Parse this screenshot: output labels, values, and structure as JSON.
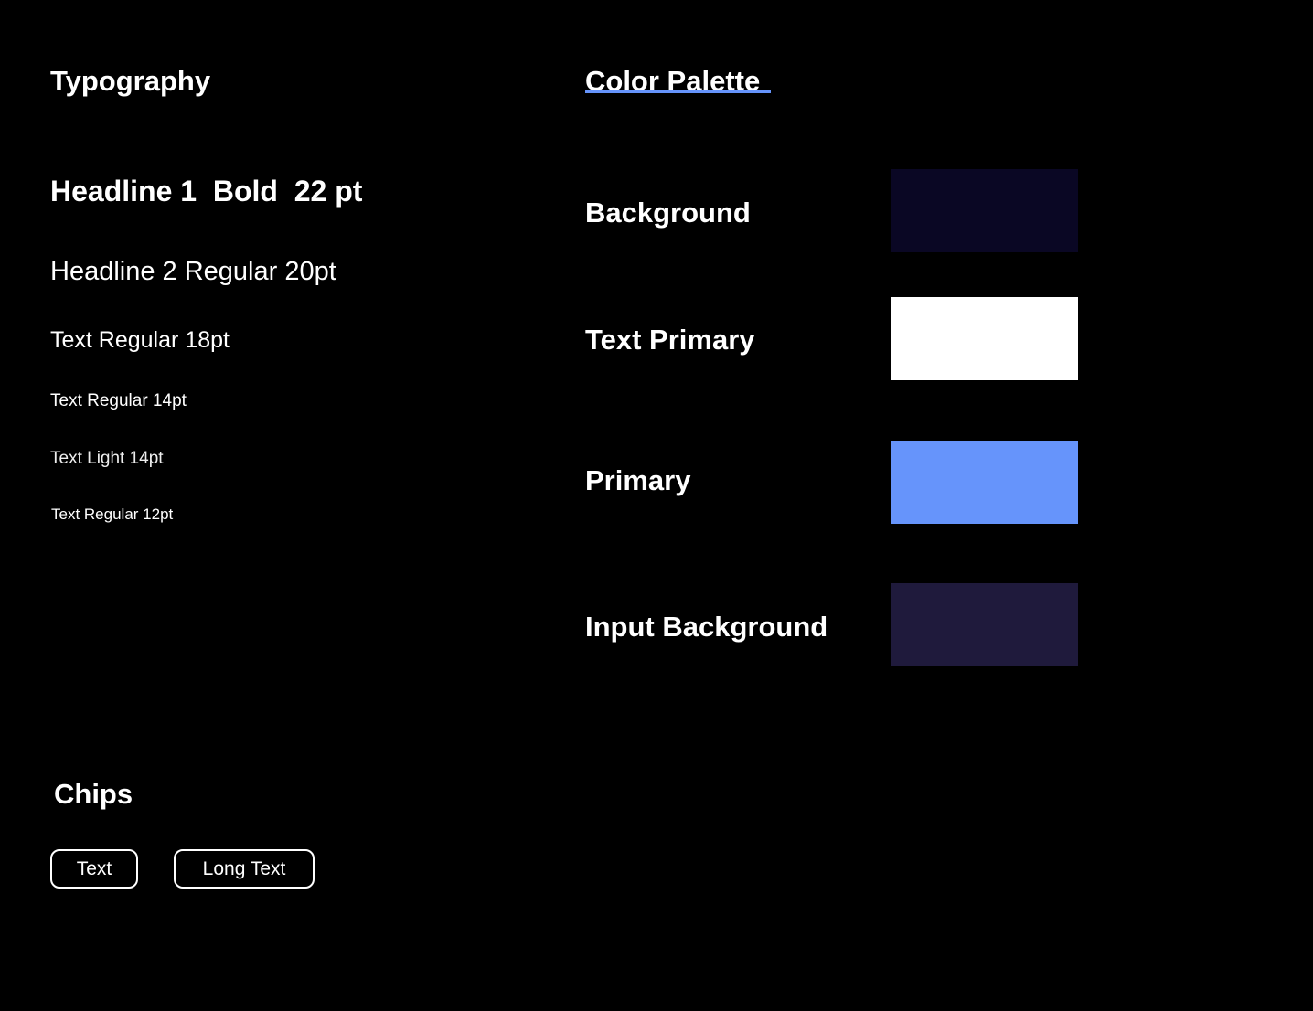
{
  "typography": {
    "title": "Typography",
    "samples": {
      "h1": "Headline 1  Bold  22 pt",
      "h2": "Headline 2 Regular 20pt",
      "text18": "Text Regular 18pt",
      "text14": "Text Regular 14pt",
      "light14": "Text Light 14pt",
      "text12": "Text Regular 12pt"
    }
  },
  "palette": {
    "title": "Color Palette",
    "accent_underline_color": "#6694fb",
    "swatches": [
      {
        "label": "Background",
        "color": "#0a0724"
      },
      {
        "label": "Text Primary",
        "color": "#ffffff"
      },
      {
        "label": "Primary",
        "color": "#6694fb"
      },
      {
        "label": "Input Background",
        "color": "#1f1a3c"
      }
    ]
  },
  "chips": {
    "title": "Chips",
    "items": [
      {
        "label": "Text"
      },
      {
        "label": "Long Text"
      }
    ]
  }
}
